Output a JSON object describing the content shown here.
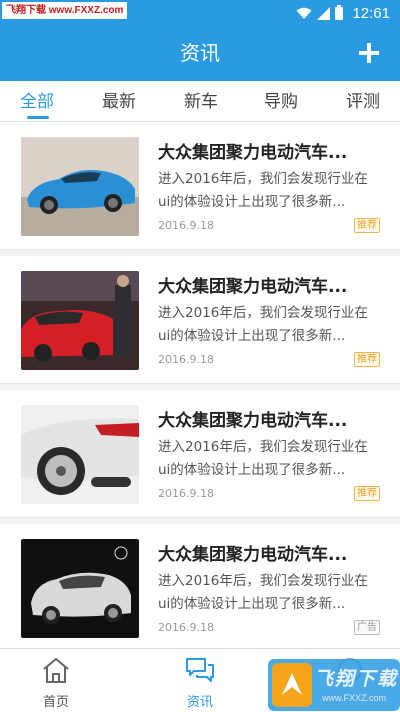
{
  "statusbar": {
    "watermark": "飞翔下载 www.FXXZ.com",
    "time": "12:61",
    "icons": [
      "wifi-icon",
      "signal-icon",
      "battery-icon"
    ]
  },
  "header": {
    "title": "资讯",
    "action_icon": "plus-icon"
  },
  "tabs": [
    {
      "label": "全部",
      "active": true
    },
    {
      "label": "最新"
    },
    {
      "label": "新车"
    },
    {
      "label": "导购"
    },
    {
      "label": "评测"
    }
  ],
  "articles": [
    {
      "title": "大众集团聚力电动汽车...",
      "desc_line1": "进入2016年后，我们会发现行业在",
      "desc_line2": "ui的体验设计上出现了很多新...",
      "date": "2016.9.18",
      "badge": "推荐"
    },
    {
      "title": "大众集团聚力电动汽车...",
      "desc_line1": "进入2016年后，我们会发现行业在",
      "desc_line2": "ui的体验设计上出现了很多新...",
      "date": "2016.9.18",
      "badge": "推荐"
    },
    {
      "title": "大众集团聚力电动汽车...",
      "desc_line1": "进入2016年后，我们会发现行业在",
      "desc_line2": "ui的体验设计上出现了很多新...",
      "date": "2016.9.18",
      "badge": "推荐"
    },
    {
      "title": "大众集团聚力电动汽车...",
      "desc_line1": "进入2016年后，我们会发现行业在",
      "desc_line2": "ui的体验设计上出现了很多新...",
      "date": "2016.9.18",
      "badge": "广告"
    }
  ],
  "bottom_nav": [
    {
      "label": "首页",
      "icon": "home-icon"
    },
    {
      "label": "资讯",
      "icon": "chat-bubbles-icon",
      "active": true
    }
  ],
  "corner_watermark": {
    "text": "飞翔下载",
    "url": "www.FXXZ.com"
  },
  "colors": {
    "accent": "#2a9be3",
    "badge_recommend": "#f0a020",
    "badge_ad": "#999999"
  }
}
